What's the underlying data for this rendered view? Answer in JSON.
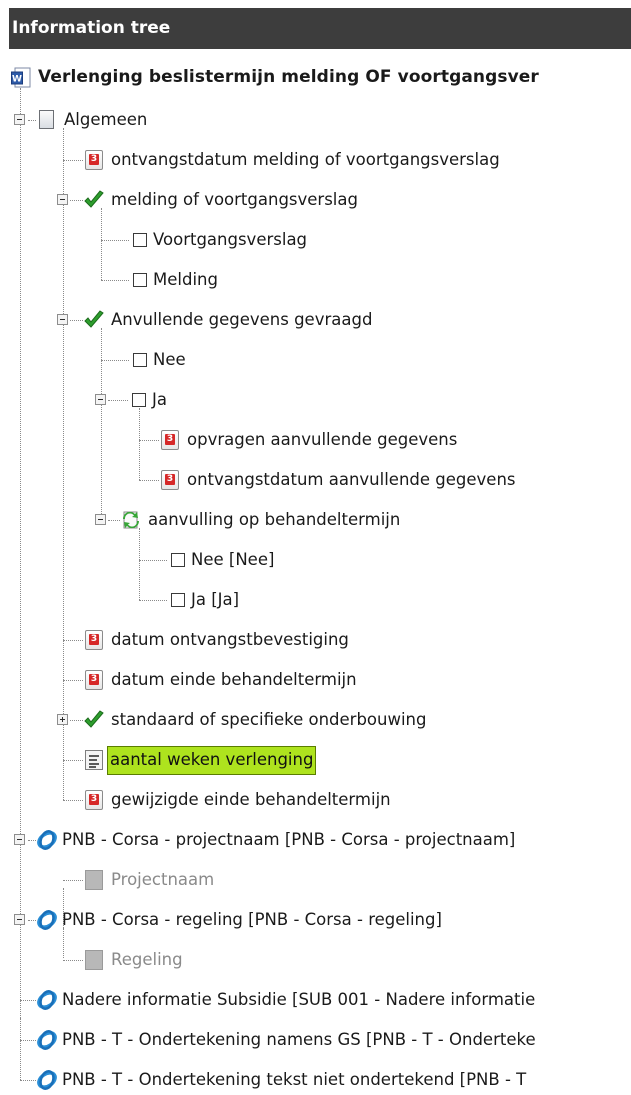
{
  "panel": {
    "title": "Information tree"
  },
  "tree": {
    "root": "Verlenging beslistermijn melding OF voortgangsver",
    "algemeen": "Algemeen",
    "items": [
      "ontvangstdatum melding of voortgangsverslag",
      "melding of voortgangsverslag",
      "Voortgangsverslag",
      "Melding",
      "Anvullende gegevens gevraagd",
      "Nee",
      "Ja",
      "opvragen aanvullende gegevens",
      "ontvangstdatum aanvullende gegevens",
      "aanvulling op behandeltermijn",
      "Nee [Nee]",
      "Ja [Ja]",
      "datum ontvangstbevestiging",
      "datum einde behandeltermijn",
      "standaard of specifieke onderbouwing",
      "aantal weken verlenging",
      "gewijzigde einde behandeltermijn",
      "PNB - Corsa - projectnaam [PNB - Corsa - projectnaam]",
      "Projectnaam",
      "PNB - Corsa - regeling [PNB - Corsa - regeling]",
      "Regeling",
      "Nadere informatie Subsidie [SUB 001 - Nadere informatie",
      "PNB - T - Ondertekening namens GS [PNB - T - Onderteke",
      "PNB - T - Ondertekening tekst niet ondertekend [PNB - T"
    ]
  },
  "colors": {
    "header_bg": "#3d3d3d",
    "highlight": "#aee31e",
    "check": "#2e9e2e",
    "ring": "#2a8fd8"
  }
}
